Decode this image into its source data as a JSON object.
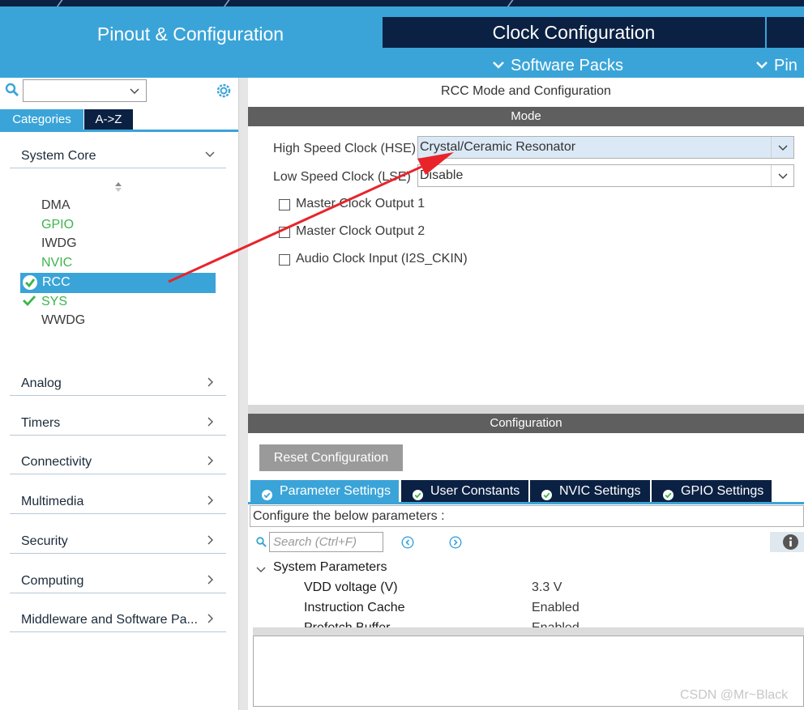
{
  "header": {
    "tabs": [
      {
        "label": "Pinout & Configuration"
      },
      {
        "label": "Clock Configuration"
      }
    ],
    "sub_menus": [
      {
        "label": "Software Packs"
      },
      {
        "label": "Pin"
      }
    ]
  },
  "sidebar": {
    "tabs": {
      "categories": "Categories",
      "az": "A->Z"
    },
    "system_core": {
      "label": "System Core",
      "items": [
        {
          "label": "DMA",
          "state": "default"
        },
        {
          "label": "GPIO",
          "state": "configured"
        },
        {
          "label": "IWDG",
          "state": "default"
        },
        {
          "label": "NVIC",
          "state": "configured"
        },
        {
          "label": "RCC",
          "state": "selected-checked"
        },
        {
          "label": "SYS",
          "state": "checked"
        },
        {
          "label": "WWDG",
          "state": "default"
        }
      ]
    },
    "sections": [
      {
        "label": "Analog"
      },
      {
        "label": "Timers"
      },
      {
        "label": "Connectivity"
      },
      {
        "label": "Multimedia"
      },
      {
        "label": "Security"
      },
      {
        "label": "Computing"
      },
      {
        "label": "Middleware and Software Pa..."
      }
    ]
  },
  "main": {
    "title": "RCC Mode and Configuration",
    "mode": {
      "header": "Mode",
      "hse": {
        "label": "High Speed Clock (HSE)",
        "value": "Crystal/Ceramic Resonator"
      },
      "lse": {
        "label": "Low Speed Clock (LSE)",
        "value": "Disable"
      },
      "checkboxes": [
        {
          "label": "Master Clock Output 1",
          "checked": false
        },
        {
          "label": "Master Clock Output 2",
          "checked": false
        },
        {
          "label": "Audio Clock Input (I2S_CKIN)",
          "checked": false
        }
      ]
    },
    "configuration": {
      "header": "Configuration",
      "reset_button": "Reset Configuration",
      "tabs": [
        {
          "label": "Parameter Settings",
          "active": true
        },
        {
          "label": "User Constants",
          "active": false
        },
        {
          "label": "NVIC Settings",
          "active": false
        },
        {
          "label": "GPIO Settings",
          "active": false
        }
      ],
      "configure_text": "Configure the below parameters :",
      "search_placeholder": "Search (Ctrl+F)",
      "group": "System Parameters",
      "params": [
        {
          "label": "VDD voltage (V)",
          "value": "3.3 V"
        },
        {
          "label": "Instruction Cache",
          "value": "Enabled"
        },
        {
          "label": "Prefetch Buffer",
          "value": "Enabled"
        }
      ]
    }
  },
  "annotation": {
    "arrow_color": "#e8242b"
  },
  "watermark": "CSDN @Mr~Black",
  "colors": {
    "accent": "#3aa4d8",
    "navy": "#0b2143",
    "configured_green": "#3cb54a",
    "band_grey": "#5f5f5f"
  }
}
